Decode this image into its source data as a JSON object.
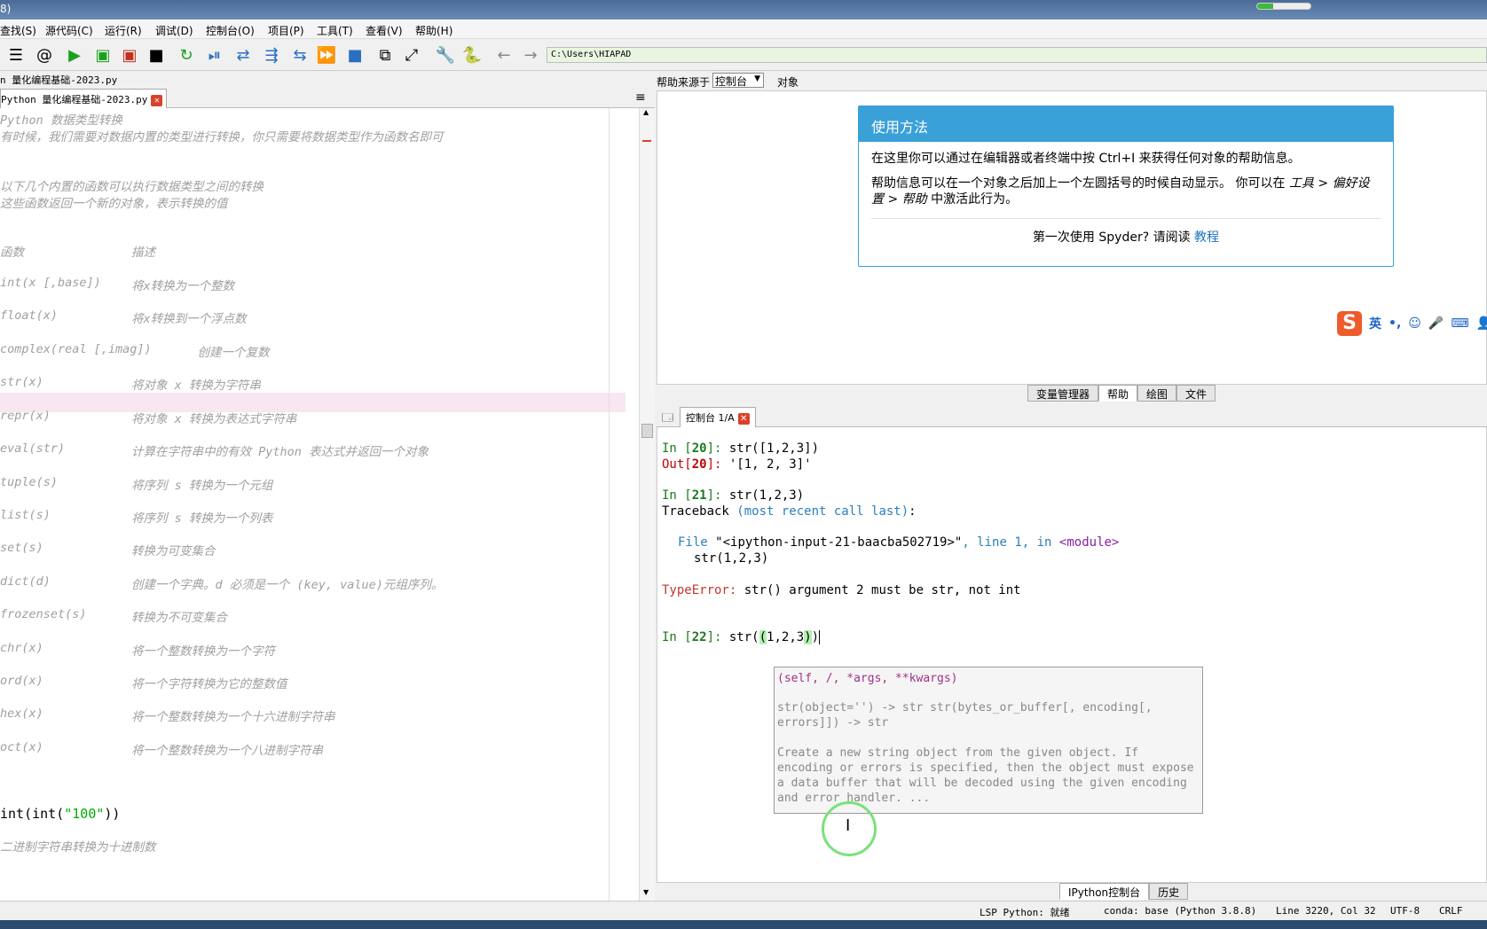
{
  "window": {
    "title_fragment": "8)",
    "progress": 0.3
  },
  "menu": [
    "查找(S)",
    "源代码(C)",
    "运行(R)",
    "调试(D)",
    "控制台(O)",
    "项目(P)",
    "工具(T)",
    "查看(V)",
    "帮助(H)"
  ],
  "toolbar": {
    "path": "C:\\Users\\HIAPAD",
    "icons": [
      "list-icon",
      "at-icon",
      "run-icon",
      "run-cell-icon",
      "run-cell-advance-icon",
      "run-selection-icon",
      "rerun-icon",
      "debug-icon",
      "step-icon",
      "step-into-icon",
      "step-return-icon",
      "continue-icon",
      "stop-icon",
      "maximize-icon",
      "fullscreen-icon",
      "wrench-icon",
      "python-icon",
      "back-icon",
      "forward-icon"
    ]
  },
  "editor": {
    "file_title": "n 量化编程基础-2023.py",
    "tab_label": "Python 量化编程基础-2023.py",
    "lines": [
      {
        "c": "Python 数据类型转换",
        "d": ""
      },
      {
        "c": "有时候，我们需要对数据内置的类型进行转换，你只需要将数据类型作为函数名即可",
        "d": ""
      },
      {
        "c": "以下几个内置的函数可以执行数据类型之间的转换",
        "d": ""
      },
      {
        "c": "这些函数返回一个新的对象，表示转换的值",
        "d": ""
      },
      {
        "c": "函数",
        "d": "描述"
      },
      {
        "c": "int(x [,base])",
        "d": "将x转换为一个整数"
      },
      {
        "c": "float(x)",
        "d": "将x转换到一个浮点数"
      },
      {
        "c": "complex(real [,imag])",
        "d": "    创建一个复数"
      },
      {
        "c": "str(x)",
        "d": "将对象 x 转换为字符串"
      },
      {
        "c": "repr(x)",
        "d": "将对象 x 转换为表达式字符串"
      },
      {
        "c": "eval(str)",
        "d": "计算在字符串中的有效 Python 表达式并返回一个对象"
      },
      {
        "c": "tuple(s)",
        "d": "将序列 s 转换为一个元组"
      },
      {
        "c": "list(s)",
        "d": "将序列 s 转换为一个列表"
      },
      {
        "c": "set(s)",
        "d": "转换为可变集合"
      },
      {
        "c": "dict(d)",
        "d": "创建一个字典。d 必须是一个 (key, value)元组序列。"
      },
      {
        "c": "frozenset(s)",
        "d": "转换为不可变集合"
      },
      {
        "c": "chr(x)",
        "d": "将一个整数转换为一个字符"
      },
      {
        "c": "ord(x)",
        "d": "将一个字符转换为它的整数值"
      },
      {
        "c": "hex(x)",
        "d": "将一个整数转换为一个十六进制字符串"
      },
      {
        "c": "oct(x)",
        "d": "将一个整数转换为一个八进制字符串"
      }
    ],
    "code_line_a": "int(int(",
    "code_line_b": "\"100\"",
    "code_line_c": "))",
    "last_comment": "二进制字符串转换为十进制数"
  },
  "help": {
    "source_label": "帮助来源于",
    "source_value": "控制台",
    "object_label": "对象",
    "usage_title": "使用方法",
    "p1": "在这里你可以通过在编辑器或者终端中按 Ctrl+I 来获得任何对象的帮助信息。",
    "p2a": "帮助信息可以在一个对象之后加上一个左圆括号的时候自动显示。 你可以在 ",
    "p2b": "工具 > 偏好设置 > 帮助",
    "p2c": " 中激活此行为。",
    "first_time": "第一次使用 Spyder? 请阅读 ",
    "tutorial": "教程",
    "ime_label": "英"
  },
  "pane_tabs": [
    "变量管理器",
    "帮助",
    "绘图",
    "文件"
  ],
  "console": {
    "tab_label": "控制台 1/A",
    "in20": "str([1,2,3])",
    "out20": "'[1, 2, 3]'",
    "in21": "str(1,2,3)",
    "traceback": "Traceback ",
    "traceback_paren": "(most recent call last)",
    "file_line_a": "File ",
    "file_line_b": "\"<ipython-input-21-baacba502719>\"",
    "file_line_c": ", line ",
    "file_line_d": "1",
    "file_line_e": ", in ",
    "file_line_f": "<module>",
    "err_src": "str(1,2,3)",
    "error_type": "TypeError:",
    "error_msg": " str() argument 2 must be str, not int",
    "in22_a": "str(",
    "in22_b": "(",
    "in22_c": "1,2,3",
    "in22_d": ")",
    "in22_e": ")",
    "calltip_sig": "(self, /, *args, **kwargs)",
    "calltip_body": "str(object='') -> str str(bytes_or_buffer[, encoding[,\nerrors]]) -> str\n\nCreate a new string object from the given object. If\nencoding or errors is specified, then the object must expose\na data buffer that will be decoded using the given encoding\nand error handler. ..."
  },
  "console_tabs": [
    "IPython控制台",
    "历史"
  ],
  "status": {
    "lsp": "LSP Python: 就绪",
    "conda": "conda: base (Python 3.8.8)",
    "position": "Line 3220, Col 32",
    "encoding": "UTF-8",
    "eol": "CRLF"
  }
}
